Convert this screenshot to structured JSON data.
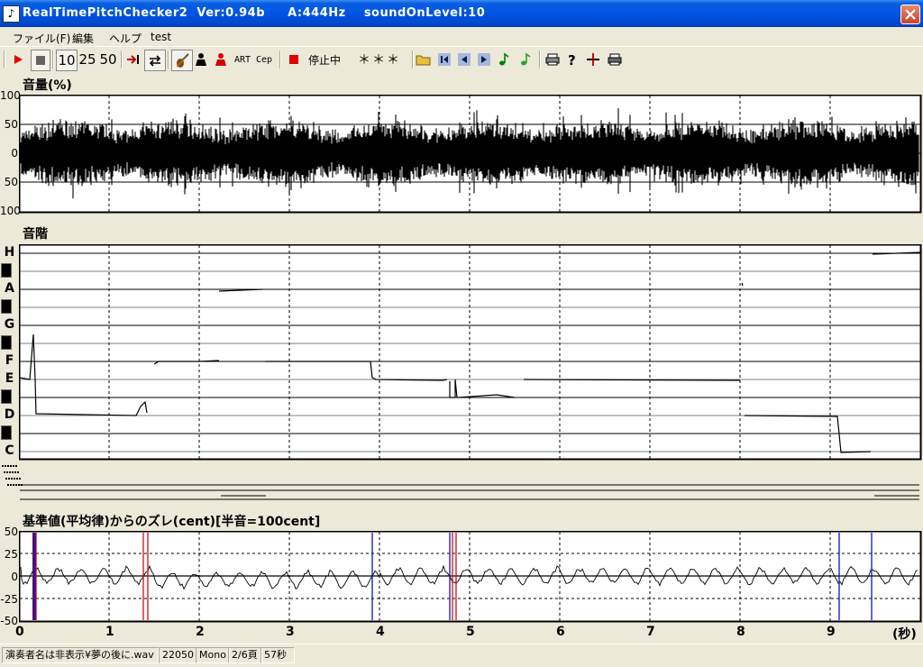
{
  "window": {
    "title": "RealTimePitchChecker2  Ver:0.94b     A:444Hz    soundOnLevel:10",
    "app_icon_glyph": "♪"
  },
  "menu": [
    "ファイル(F)",
    "編集",
    "ヘルプ",
    "test"
  ],
  "toolbar": {
    "zoom_buttons": [
      "10",
      "25",
      "50"
    ],
    "art_label": "ART",
    "cep_label": "Cep",
    "status_label": "停止中",
    "note_display": "＊＊＊"
  },
  "volume_panel": {
    "title": "音量(%)",
    "y_labels": [
      "100",
      "50",
      "0",
      "50",
      "100"
    ]
  },
  "scale_panel": {
    "title": "音階",
    "notes": [
      "H",
      "A",
      "G",
      "F",
      "E",
      "D",
      "C"
    ]
  },
  "deviation_panel": {
    "title": "基準値(平均律)からのズレ(cent)[半音=100cent]",
    "y_labels": [
      "50",
      "25",
      "0",
      "-25",
      "-50"
    ]
  },
  "x_axis": {
    "ticks": [
      "0",
      "1",
      "2",
      "3",
      "4",
      "5",
      "6",
      "7",
      "8",
      "9"
    ],
    "unit": "(秒)"
  },
  "status_bar": [
    "演奏者名は非表示¥夢の後に.wav",
    "22050",
    "Mono",
    "2/6頁",
    "57秒"
  ],
  "colors": {
    "title_bar": "#0054e3",
    "panel_bg": "#ffffff",
    "grid": "#000000",
    "red_marker": "#d01010",
    "blue_marker": "#1010c0"
  },
  "icons": [
    "play-icon",
    "stop-icon",
    "jump-end-icon",
    "loop-icon",
    "violin-icon",
    "person-black-icon",
    "person-red-icon",
    "record-icon",
    "open-folder-icon",
    "first-icon",
    "prev-icon",
    "next-icon",
    "note-green-icon",
    "note-green-alt-icon",
    "printer-icon",
    "help-icon",
    "crosshair-icon",
    "printer-alt-icon"
  ]
}
